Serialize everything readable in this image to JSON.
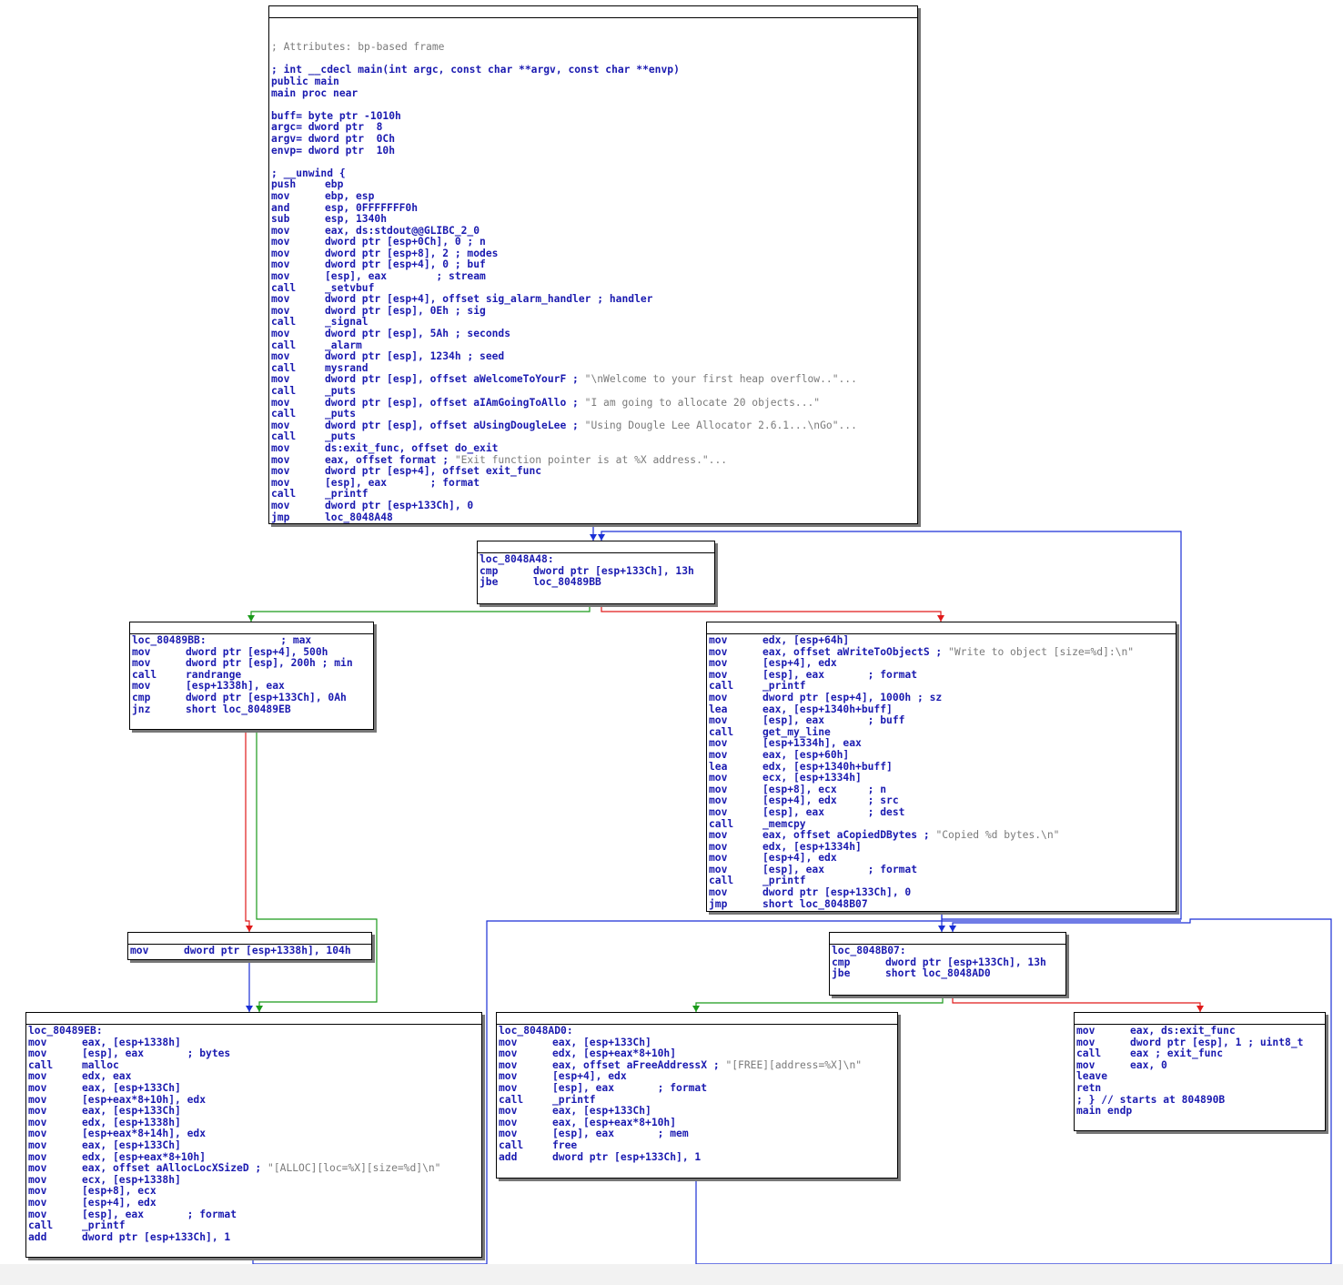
{
  "graph": {
    "nodes": [
      {
        "id": "main",
        "blank_lead": 2,
        "lines": [
          {
            "t": "; Attributes: bp-based frame",
            "c": "cm"
          },
          {
            "blank": true
          },
          {
            "t": "; int __cdecl main(int argc, const char **argv, const char **envp)"
          },
          {
            "t": "public main"
          },
          {
            "t": "main proc near"
          },
          {
            "blank": true
          },
          {
            "t": "buff= byte ptr -1010h"
          },
          {
            "t": "argc= dword ptr  8"
          },
          {
            "t": "argv= dword ptr  0Ch"
          },
          {
            "t": "envp= dword ptr  10h"
          },
          {
            "blank": true
          },
          {
            "t": "; __unwind {"
          },
          {
            "op": "push",
            "arg": "ebp"
          },
          {
            "op": "mov",
            "arg": "ebp, esp"
          },
          {
            "op": "and",
            "arg": "esp, 0FFFFFFF0h"
          },
          {
            "op": "sub",
            "arg": "esp, 1340h"
          },
          {
            "op": "mov",
            "arg": "eax, ds:stdout@@GLIBC_2_0"
          },
          {
            "op": "mov",
            "arg": "dword ptr [esp+0Ch], 0 ; n"
          },
          {
            "op": "mov",
            "arg": "dword ptr [esp+8], 2 ; modes"
          },
          {
            "op": "mov",
            "arg": "dword ptr [esp+4], 0 ; buf"
          },
          {
            "op": "mov",
            "arg": "[esp], eax        ; stream"
          },
          {
            "op": "call",
            "arg": "_setvbuf"
          },
          {
            "op": "mov",
            "arg": "dword ptr [esp+4], offset sig_alarm_handler ; handler"
          },
          {
            "op": "mov",
            "arg": "dword ptr [esp], 0Eh ; sig"
          },
          {
            "op": "call",
            "arg": "_signal"
          },
          {
            "op": "mov",
            "arg": "dword ptr [esp], 5Ah ; seconds"
          },
          {
            "op": "call",
            "arg": "_alarm"
          },
          {
            "op": "mov",
            "arg": "dword ptr [esp], 1234h ; seed"
          },
          {
            "op": "call",
            "arg": "mysrand"
          },
          {
            "op": "mov",
            "arg": "dword ptr [esp], offset aWelcomeToYourF ; ",
            "s": "\"\\nWelcome to your first heap overflow..\"..."
          },
          {
            "op": "call",
            "arg": "_puts"
          },
          {
            "op": "mov",
            "arg": "dword ptr [esp], offset aIAmGoingToAllo ; ",
            "s": "\"I am going to allocate 20 objects...\""
          },
          {
            "op": "call",
            "arg": "_puts"
          },
          {
            "op": "mov",
            "arg": "dword ptr [esp], offset aUsingDougleLee ; ",
            "s": "\"Using Dougle Lee Allocator 2.6.1...\\nGo\"..."
          },
          {
            "op": "call",
            "arg": "_puts"
          },
          {
            "op": "mov",
            "arg": "ds:exit_func, offset do_exit"
          },
          {
            "op": "mov",
            "arg": "eax, offset format ; ",
            "s": "\"Exit function pointer is at %X address.\"..."
          },
          {
            "op": "mov",
            "arg": "dword ptr [esp+4], offset exit_func"
          },
          {
            "op": "mov",
            "arg": "[esp], eax       ; format"
          },
          {
            "op": "call",
            "arg": "_printf"
          },
          {
            "op": "mov",
            "arg": "dword ptr [esp+133Ch], 0"
          },
          {
            "op": "jmp",
            "arg": "loc_8048A48"
          }
        ]
      },
      {
        "id": "loc_8048A48",
        "lines": [
          {
            "t": "loc_8048A48:"
          },
          {
            "op": "cmp",
            "arg": "dword ptr [esp+133Ch], 13h"
          },
          {
            "op": "jbe",
            "arg": "loc_80489BB"
          }
        ]
      },
      {
        "id": "loc_80489BB",
        "lines": [
          {
            "t": "loc_80489BB:            ; max"
          },
          {
            "op": "mov",
            "arg": "dword ptr [esp+4], 500h"
          },
          {
            "op": "mov",
            "arg": "dword ptr [esp], 200h ; min"
          },
          {
            "op": "call",
            "arg": "randrange"
          },
          {
            "op": "mov",
            "arg": "[esp+1338h], eax"
          },
          {
            "op": "cmp",
            "arg": "dword ptr [esp+133Ch], 0Ah"
          },
          {
            "op": "jnz",
            "arg": "short loc_80489EB"
          }
        ]
      },
      {
        "id": "write_block",
        "lines": [
          {
            "op": "mov",
            "arg": "edx, [esp+64h]"
          },
          {
            "op": "mov",
            "arg": "eax, offset aWriteToObjectS ; ",
            "s": "\"Write to object [size=%d]:\\n\""
          },
          {
            "op": "mov",
            "arg": "[esp+4], edx"
          },
          {
            "op": "mov",
            "arg": "[esp], eax       ; format"
          },
          {
            "op": "call",
            "arg": "_printf"
          },
          {
            "op": "mov",
            "arg": "dword ptr [esp+4], 1000h ; sz"
          },
          {
            "op": "lea",
            "arg": "eax, [esp+1340h+buff]"
          },
          {
            "op": "mov",
            "arg": "[esp], eax       ; buff"
          },
          {
            "op": "call",
            "arg": "get_my_line"
          },
          {
            "op": "mov",
            "arg": "[esp+1334h], eax"
          },
          {
            "op": "mov",
            "arg": "eax, [esp+60h]"
          },
          {
            "op": "lea",
            "arg": "edx, [esp+1340h+buff]"
          },
          {
            "op": "mov",
            "arg": "ecx, [esp+1334h]"
          },
          {
            "op": "mov",
            "arg": "[esp+8], ecx     ; n"
          },
          {
            "op": "mov",
            "arg": "[esp+4], edx     ; src"
          },
          {
            "op": "mov",
            "arg": "[esp], eax       ; dest"
          },
          {
            "op": "call",
            "arg": "_memcpy"
          },
          {
            "op": "mov",
            "arg": "eax, offset aCopiedDBytes ; ",
            "s": "\"Copied %d bytes.\\n\""
          },
          {
            "op": "mov",
            "arg": "edx, [esp+1334h]"
          },
          {
            "op": "mov",
            "arg": "[esp+4], edx"
          },
          {
            "op": "mov",
            "arg": "[esp], eax       ; format"
          },
          {
            "op": "call",
            "arg": "_printf"
          },
          {
            "op": "mov",
            "arg": "dword ptr [esp+133Ch], 0"
          },
          {
            "op": "jmp",
            "arg": "short loc_8048B07"
          }
        ]
      },
      {
        "id": "mov_104",
        "lines": [
          {
            "op": "mov",
            "arg": "dword ptr [esp+1338h], 104h"
          }
        ]
      },
      {
        "id": "loc_8048B07",
        "lines": [
          {
            "t": "loc_8048B07:"
          },
          {
            "op": "cmp",
            "arg": "dword ptr [esp+133Ch], 13h"
          },
          {
            "op": "jbe",
            "arg": "short loc_8048AD0"
          }
        ]
      },
      {
        "id": "loc_80489EB",
        "lines": [
          {
            "t": "loc_80489EB:"
          },
          {
            "op": "mov",
            "arg": "eax, [esp+1338h]"
          },
          {
            "op": "mov",
            "arg": "[esp], eax       ; bytes"
          },
          {
            "op": "call",
            "arg": "malloc"
          },
          {
            "op": "mov",
            "arg": "edx, eax"
          },
          {
            "op": "mov",
            "arg": "eax, [esp+133Ch]"
          },
          {
            "op": "mov",
            "arg": "[esp+eax*8+10h], edx"
          },
          {
            "op": "mov",
            "arg": "eax, [esp+133Ch]"
          },
          {
            "op": "mov",
            "arg": "edx, [esp+1338h]"
          },
          {
            "op": "mov",
            "arg": "[esp+eax*8+14h], edx"
          },
          {
            "op": "mov",
            "arg": "eax, [esp+133Ch]"
          },
          {
            "op": "mov",
            "arg": "edx, [esp+eax*8+10h]"
          },
          {
            "op": "mov",
            "arg": "eax, offset aAllocLocXSizeD ; ",
            "s": "\"[ALLOC][loc=%X][size=%d]\\n\""
          },
          {
            "op": "mov",
            "arg": "ecx, [esp+1338h]"
          },
          {
            "op": "mov",
            "arg": "[esp+8], ecx"
          },
          {
            "op": "mov",
            "arg": "[esp+4], edx"
          },
          {
            "op": "mov",
            "arg": "[esp], eax       ; format"
          },
          {
            "op": "call",
            "arg": "_printf"
          },
          {
            "op": "add",
            "arg": "dword ptr [esp+133Ch], 1"
          }
        ]
      },
      {
        "id": "loc_8048AD0",
        "lines": [
          {
            "t": "loc_8048AD0:"
          },
          {
            "op": "mov",
            "arg": "eax, [esp+133Ch]"
          },
          {
            "op": "mov",
            "arg": "edx, [esp+eax*8+10h]"
          },
          {
            "op": "mov",
            "arg": "eax, offset aFreeAddressX ; ",
            "s": "\"[FREE][address=%X]\\n\""
          },
          {
            "op": "mov",
            "arg": "[esp+4], edx"
          },
          {
            "op": "mov",
            "arg": "[esp], eax       ; format"
          },
          {
            "op": "call",
            "arg": "_printf"
          },
          {
            "op": "mov",
            "arg": "eax, [esp+133Ch]"
          },
          {
            "op": "mov",
            "arg": "eax, [esp+eax*8+10h]"
          },
          {
            "op": "mov",
            "arg": "[esp], eax       ; mem"
          },
          {
            "op": "call",
            "arg": "free"
          },
          {
            "op": "add",
            "arg": "dword ptr [esp+133Ch], 1"
          }
        ]
      },
      {
        "id": "exit_block",
        "lines": [
          {
            "op": "mov",
            "arg": "eax, ds:exit_func"
          },
          {
            "op": "mov",
            "arg": "dword ptr [esp], 1 ; uint8_t"
          },
          {
            "op": "call",
            "arg": "eax ; exit_func"
          },
          {
            "op": "mov",
            "arg": "eax, 0"
          },
          {
            "t": "leave"
          },
          {
            "t": "retn"
          },
          {
            "t": "; } // starts at 804890B"
          },
          {
            "t": "main endp"
          }
        ]
      }
    ],
    "edge_colors": {
      "unconditional": "#1a2fd6",
      "true": "#1a9a1a",
      "false": "#e01a1a"
    }
  }
}
